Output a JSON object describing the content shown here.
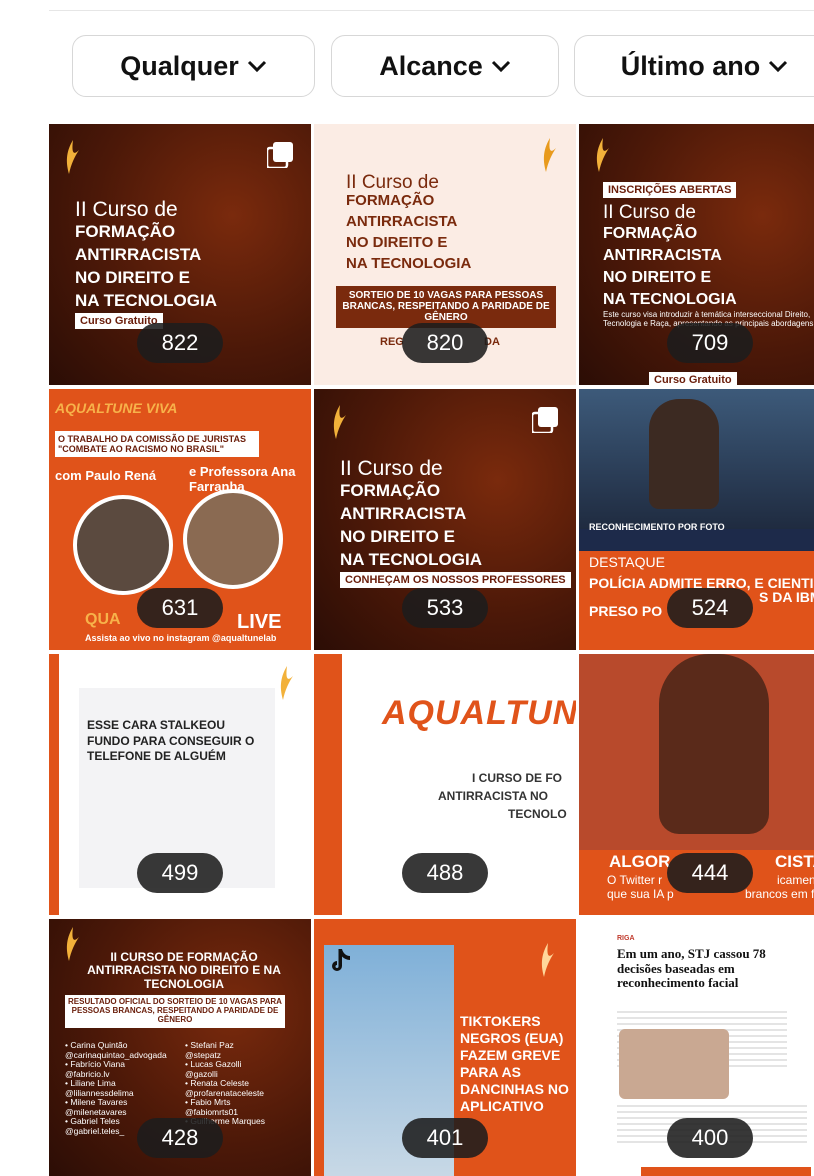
{
  "filters": [
    {
      "label": "Qualquer"
    },
    {
      "label": "Alcance"
    },
    {
      "label": "Último ano"
    }
  ],
  "posts": [
    {
      "views": "822",
      "lines": [
        "II Curso de",
        "FORMAÇÃO",
        "ANTIRRACISTA",
        "NO DIREITO E",
        "NA TECNOLOGIA"
      ],
      "tag": "Curso Gratuito"
    },
    {
      "views": "820",
      "lines": [
        "II Curso de",
        "FORMAÇÃO",
        "ANTIRRACISTA",
        "NO DIREITO E",
        "NA TECNOLOGIA"
      ],
      "banner": "SORTEIO DE 10 VAGAS PARA PESSOAS BRANCAS, RESPEITANDO A PARIDADE DE GÊNERO",
      "footer": "REG",
      "footer2": "DA"
    },
    {
      "views": "709",
      "lines": [
        "II Curso de",
        "FORMAÇÃO",
        "ANTIRRACISTA",
        "NO DIREITO E",
        "NA TECNOLOGIA"
      ],
      "topTag": "INSCRIÇÕES ABERTAS",
      "desc": "Este curso visa introduzir à temática interseccional Direito, Tecnologia e Raça, apresentando as principais abordagens",
      "tag": "Curso Gratuito"
    },
    {
      "views": "631",
      "header": "AQUALTUNE VIVA",
      "sub": "O TRABALHO DA COMISSÃO DE JURISTAS \"COMBATE AO RACISMO NO BRASIL\"",
      "left": "com Paulo Rená",
      "right": "e Professora Ana Farranha",
      "live": "LIVE",
      "qua": "QUA",
      "footer": "Assista ao vivo no instagram @aqualtunelab"
    },
    {
      "views": "533",
      "lines": [
        "II Curso de",
        "FORMAÇÃO",
        "ANTIRRACISTA",
        "NO DIREITO E",
        "NA TECNOLOGIA"
      ],
      "tag": "CONHEÇAM OS NOSSOS PROFESSORES"
    },
    {
      "views": "524",
      "ticker": "RECONHECIMENTO POR FOTO",
      "label": "DESTAQUE",
      "headline": "POLÍCIA ADMITE ERRO, E CIENTISTA",
      "headline2": "S DA IBM",
      "headline3": "PRESO PO"
    },
    {
      "views": "499",
      "title": "ESSE CARA STALKEOU FUNDO PARA CONSEGUIR O TELEFONE DE ALGUÉM",
      "url": "https://www.nucleo.jor.br/garimpo/stalkeou-fundo-modo/"
    },
    {
      "views": "488",
      "brand": "AQUALTUN",
      "line1": "I CURSO DE FO",
      "line2": "ANTIRRACISTA NO",
      "line3": "TECNOLO"
    },
    {
      "views": "444",
      "title": "ALGOR",
      "title2": "CISTA:",
      "sub": "O Twitter r",
      "sub2": "icamente o",
      "sub3": "que sua IA p",
      "sub4": "brancos em fotos"
    },
    {
      "views": "428",
      "title": "II CURSO DE FORMAÇÃO ANTIRRACISTA NO DIREITO E NA TECNOLOGIA",
      "result": "RESULTADO OFICIAL DO SORTEIO DE 10 VAGAS PARA PESSOAS BRANCAS, RESPEITANDO A PARIDADE DE GÊNERO",
      "col1": [
        "• Carina Quintão",
        "@carinaquintao_advogada",
        "• Fabrício Viana",
        "@fabricio.lv",
        "• Liliane Lima",
        "@liliannessdelima",
        "• Milene Tavares",
        "@milenetavares",
        "• Gabriel Teles",
        "@gabriel.teles_"
      ],
      "col2": [
        "• Stefani Paz",
        "@stepatz",
        "• Lucas Gazolli",
        "@gazolli",
        "• Renata Celeste",
        "@profarenataceleste",
        "• Fabio Mrts",
        "@fabiomrts01",
        "• Guilherme Marques"
      ]
    },
    {
      "views": "401",
      "lines": [
        "TIKTOKERS",
        "NEGROS (EUA)",
        "FAZEM GREVE",
        "PARA AS",
        "DANCINHAS NO",
        "APLICATIVO"
      ]
    },
    {
      "views": "400",
      "section": "RIGA",
      "headline": "Em um ano, STJ cassou 78 decisões baseadas em reconhecimento facial"
    }
  ],
  "colors": {
    "orange": "#e0531a",
    "dark": "#4b1808",
    "cream": "#fbece4"
  }
}
